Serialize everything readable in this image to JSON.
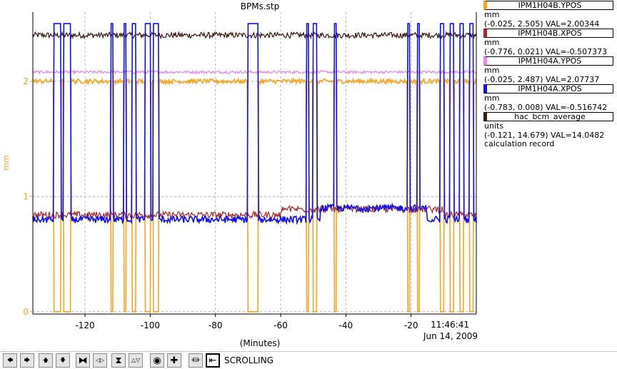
{
  "window": {
    "title": "BPMs.stp"
  },
  "chart_data": {
    "type": "line",
    "title": "BPMs.stp",
    "xlabel": "(Minutes)",
    "ylabel": "mm",
    "xlim": [
      -136,
      0
    ],
    "ylim": [
      -0.02,
      2.6
    ],
    "x_ticks": [
      "-120",
      "-100",
      "-80",
      "-60",
      "-40",
      "-20"
    ],
    "x_tick_values": [
      -120,
      -100,
      -80,
      -60,
      -40,
      -20
    ],
    "y_ticks": [
      "0",
      "1",
      "2"
    ],
    "y_tick_values": [
      0,
      1,
      2
    ],
    "end_time": "11:46:41",
    "end_date": "Jun 14, 2009",
    "grid": true,
    "legend_position": "right",
    "dropout_regions": [
      [
        -129.5,
        -127.5
      ],
      [
        -126.5,
        -124.5
      ],
      [
        -112,
        -111.5
      ],
      [
        -108,
        -107.5
      ],
      [
        -105.5,
        -104.5
      ],
      [
        -101.5,
        -100
      ],
      [
        -99,
        -97.5
      ],
      [
        -70,
        -67
      ],
      [
        -52,
        -51.5
      ],
      [
        -50,
        -49
      ],
      [
        -43.5,
        -43
      ],
      [
        -21,
        -20.5
      ],
      [
        -18,
        -17.5
      ],
      [
        -11,
        -10
      ],
      [
        -8,
        -7
      ],
      [
        -5,
        -4
      ],
      [
        -2,
        -1
      ]
    ],
    "series": [
      {
        "name": "IPM1H04B.YPOS",
        "color": "#f5a623",
        "base": 2.0,
        "noise": 0.02,
        "dropout_value": 0.0
      },
      {
        "name": "IPM1H04B.XPOS",
        "color": "#a52a2a",
        "base": 0.84,
        "noise": 0.03,
        "dropout_value": null
      },
      {
        "name": "IPM1H04A.YPOS",
        "color": "#ee82ee",
        "base": 2.08,
        "noise": 0.012,
        "dropout_value": null
      },
      {
        "name": "IPM1H04A.XPOS",
        "color": "#1010ee",
        "base": 0.8,
        "noise": 0.03,
        "dropout_value": 2.5
      },
      {
        "name": "hac_bcm_average",
        "color": "#3a1a0e",
        "base": 2.4,
        "noise": 0.025,
        "dropout_value": null
      }
    ]
  },
  "legend": [
    {
      "name": "IPM1H04B.YPOS",
      "color": "#f5a623",
      "lines": [
        "mm",
        "(-0.025, 2.505) VAL=2.00344"
      ]
    },
    {
      "name": "IPM1H04B.XPOS",
      "color": "#a52a2a",
      "lines": [
        "mm",
        "(-0.776, 0.021) VAL=-0.507373"
      ]
    },
    {
      "name": "IPM1H04A.YPOS",
      "color": "#ee82ee",
      "lines": [
        "mm",
        "(-0.025, 2.487) VAL=2.07737"
      ]
    },
    {
      "name": "IPM1H04A.XPOS",
      "color": "#1010ee",
      "lines": [
        "mm",
        "(-0.783, 0.008) VAL=-0.516742"
      ]
    },
    {
      "name": "hac_bcm_average",
      "color": "#3a1a0e",
      "lines": [
        "units",
        "(-0.121, 14.679) VAL=14.0482",
        "calculation record"
      ]
    }
  ],
  "toolbar": {
    "buttons": [
      {
        "name": "pan-left-button",
        "glyph": "🡄"
      },
      {
        "name": "pan-right-button",
        "glyph": "🡆"
      },
      {
        "name": "pan-up-button",
        "glyph": "🡅"
      },
      {
        "name": "pan-down-button",
        "glyph": "🡇"
      },
      {
        "name": "zoom-in-x-button",
        "glyph": "⧓"
      },
      {
        "name": "zoom-out-x-button",
        "glyph": "◁▷"
      },
      {
        "name": "zoom-in-y-button",
        "glyph": "⧗"
      },
      {
        "name": "zoom-out-y-button",
        "glyph": "△▽"
      },
      {
        "name": "auto-scale-button",
        "glyph": "◉"
      },
      {
        "name": "add-button",
        "glyph": "✚"
      },
      {
        "name": "plot-mode-button",
        "glyph": "⏛"
      },
      {
        "name": "scroll-mode-button",
        "glyph": "⇤"
      }
    ],
    "mode_label": "SCROLLING"
  }
}
